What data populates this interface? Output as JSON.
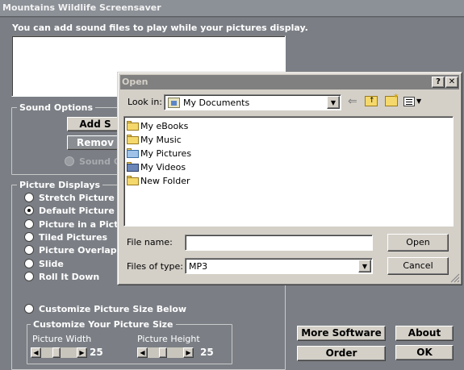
{
  "main": {
    "title": "Mountains Wildlife Screensaver",
    "intro": "You can add sound files to play while your pictures display.",
    "sound_options": {
      "title": "Sound Options",
      "add_label": "Add S",
      "remove_label": "Remov",
      "sound_radio_label": "Sound O"
    },
    "picture_displays": {
      "title": "Picture Displays",
      "options": [
        "Stretch Picture F",
        "Default Picture S",
        "Picture in a Pictu",
        "Tiled Pictures",
        "Picture Overlapp",
        "Slide",
        "Roll It Down"
      ],
      "selected_index": 1
    },
    "customize_radio": "Customize Picture Size Below",
    "customize_group": {
      "title": "Customize Your Picture Size",
      "width_label": "Picture Width",
      "width_value": "25",
      "height_label": "Picture Height",
      "height_value": "25"
    },
    "buttons": {
      "more_software": "More Software",
      "about": "About",
      "order": "Order",
      "ok": "OK"
    }
  },
  "dialog": {
    "title": "Open",
    "help_label": "?",
    "close_label": "✕",
    "look_in_label": "Look in:",
    "look_in_value": "My Documents",
    "files": [
      "My eBooks",
      "My Music",
      "My Pictures",
      "My Videos",
      "New Folder"
    ],
    "file_name_label": "File name:",
    "file_name_value": "",
    "files_of_type_label": "Files of type:",
    "files_of_type_value": "MP3",
    "open_label": "Open",
    "cancel_label": "Cancel"
  }
}
